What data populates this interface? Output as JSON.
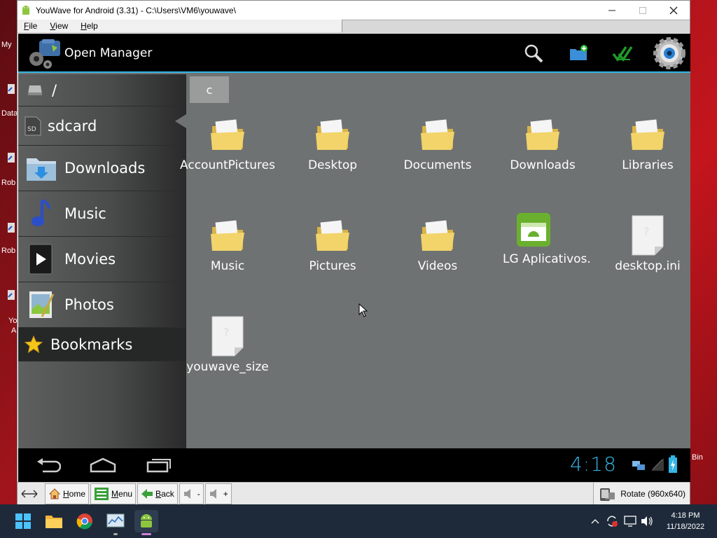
{
  "window": {
    "title": "YouWave for Android (3.31) - C:\\Users\\VM6\\youwave\\",
    "menu": [
      "File",
      "View",
      "Help"
    ]
  },
  "desktop": {
    "labels": [
      "My",
      "Data",
      "Rob",
      "Rob",
      "Yo",
      "A",
      "Bin"
    ]
  },
  "action_bar": {
    "title": "Open Manager",
    "icons": [
      "search-icon",
      "new-folder-icon",
      "multi-select-icon",
      "settings-icon"
    ]
  },
  "sidebar": {
    "root": "/",
    "sdcard": "sdcard",
    "sd_badge": "SD",
    "items": [
      {
        "label": "Downloads",
        "icon": "downloads-folder-icon"
      },
      {
        "label": "Music",
        "icon": "music-note-icon"
      },
      {
        "label": "Movies",
        "icon": "movie-play-icon"
      },
      {
        "label": "Photos",
        "icon": "photo-icon"
      }
    ],
    "bookmarks": "Bookmarks"
  },
  "breadcrumb": "c",
  "files": [
    {
      "name": "AccountPictures",
      "type": "folder"
    },
    {
      "name": "Desktop",
      "type": "folder"
    },
    {
      "name": "Documents",
      "type": "folder"
    },
    {
      "name": "Downloads",
      "type": "folder"
    },
    {
      "name": "Libraries",
      "type": "folder"
    },
    {
      "name": "Music",
      "type": "folder"
    },
    {
      "name": "Pictures",
      "type": "folder"
    },
    {
      "name": "Videos",
      "type": "folder"
    },
    {
      "name": "LG Aplicativos.",
      "type": "apk"
    },
    {
      "name": "desktop.ini",
      "type": "file"
    },
    {
      "name": "youwave_size",
      "type": "file"
    }
  ],
  "navbar": {
    "clock": "4:18",
    "icons": [
      "back-icon",
      "home-icon",
      "recent-apps-icon",
      "network-icon",
      "signal-icon",
      "battery-icon"
    ]
  },
  "youwave_toolbar": {
    "home": "Home",
    "menu": "Menu",
    "back": "Back",
    "vol_down": "-",
    "vol_up": "+",
    "rotate": "Rotate (960x640)"
  },
  "taskbar": {
    "time": "4:18 PM",
    "date": "11/18/2022"
  }
}
